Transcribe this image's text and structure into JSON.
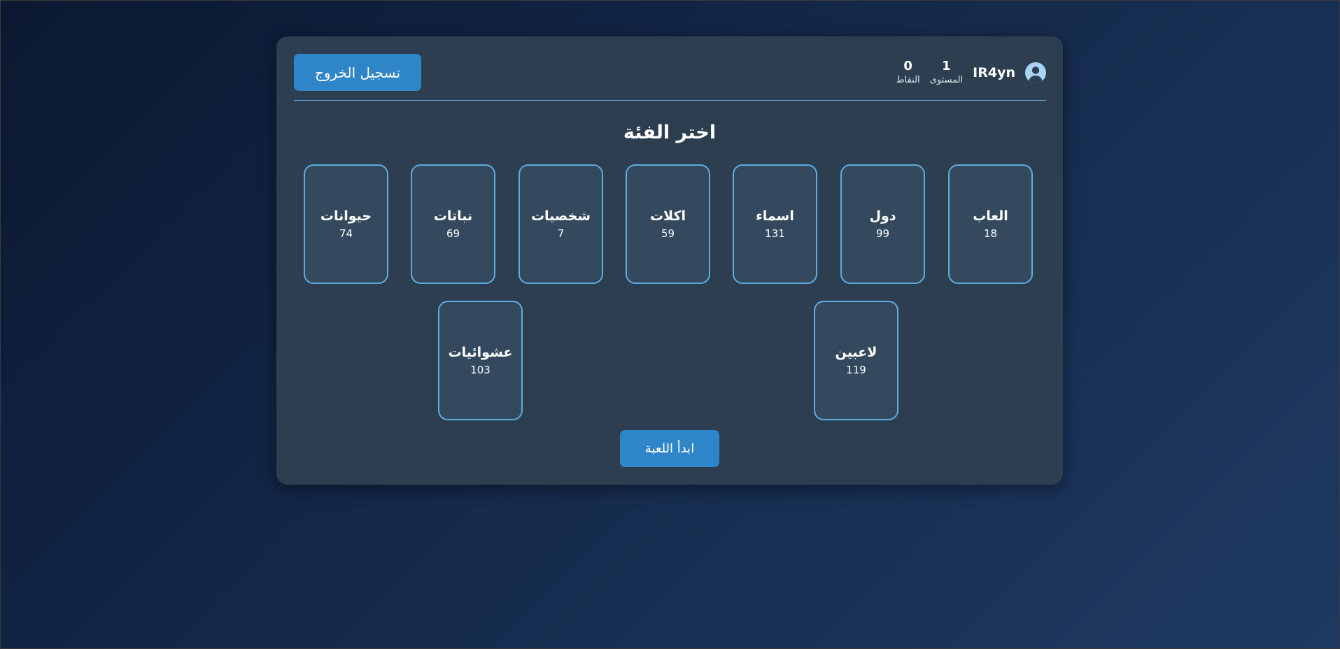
{
  "header": {
    "logout_label": "تسجيل الخروج",
    "username": "IR4yn",
    "level": {
      "value": "1",
      "label": "المستوى"
    },
    "points": {
      "value": "0",
      "label": "النقاط"
    },
    "avatar_icon": "user-circle-icon"
  },
  "main": {
    "title": "اختر الفئة",
    "categories": [
      {
        "name": "العاب",
        "count": "18"
      },
      {
        "name": "دول",
        "count": "99"
      },
      {
        "name": "اسماء",
        "count": "131"
      },
      {
        "name": "اكلات",
        "count": "59"
      },
      {
        "name": "شخصيات",
        "count": "7"
      },
      {
        "name": "نباتات",
        "count": "69"
      },
      {
        "name": "حيوانات",
        "count": "74"
      },
      {
        "name": "لاعبين",
        "count": "119"
      },
      {
        "name": "عشوائيات",
        "count": "103"
      }
    ],
    "start_label": "ابدأ اللعبة"
  },
  "colors": {
    "accent": "#2e86c8",
    "card_border": "#5dade2",
    "panel": "#2c3e50",
    "card_bg": "#34495e"
  }
}
